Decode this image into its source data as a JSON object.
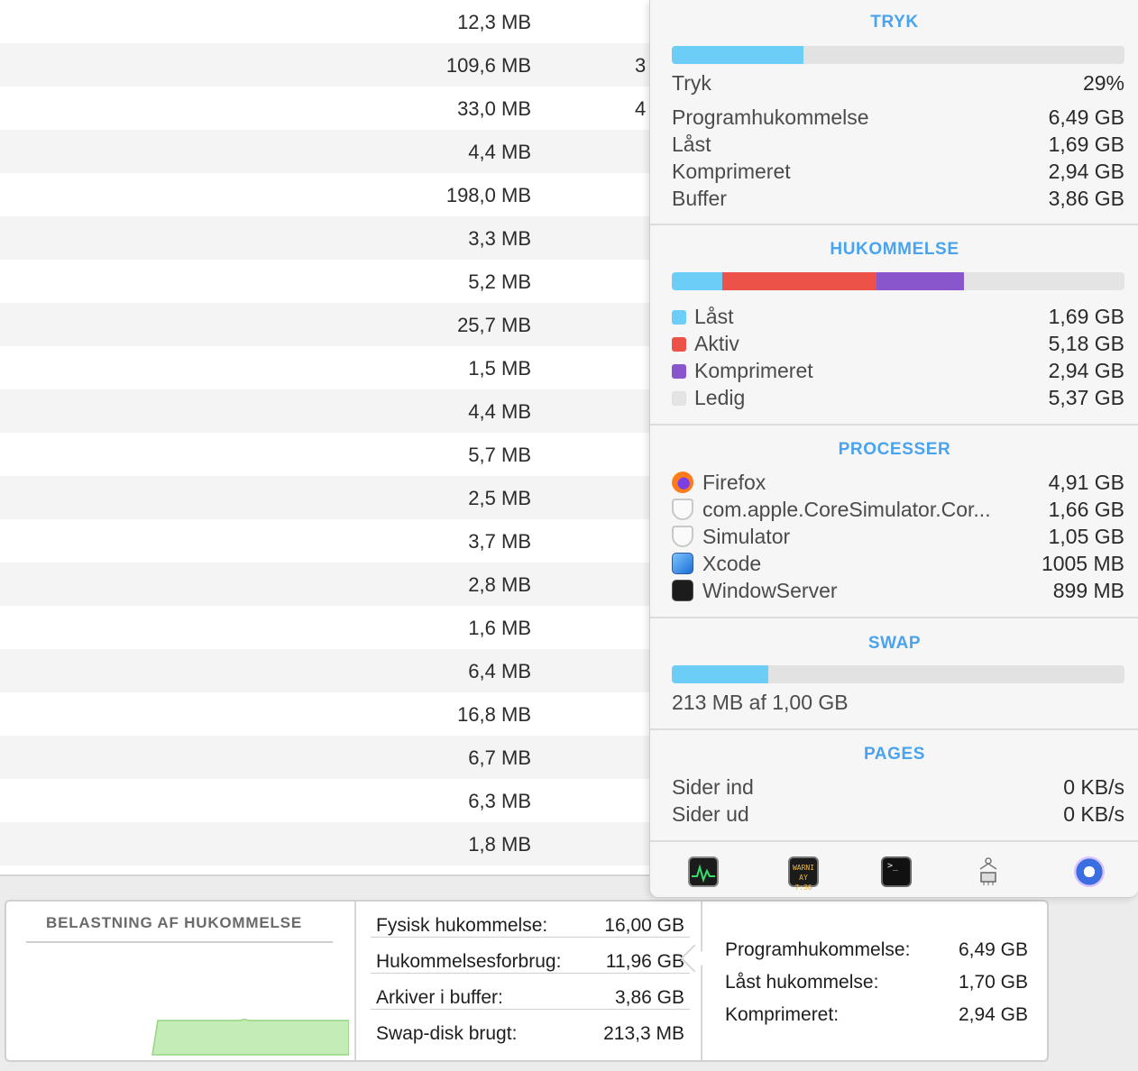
{
  "table": {
    "rows": [
      {
        "mem": "12,3 MB",
        "peek": ""
      },
      {
        "mem": "109,6 MB",
        "peek": "3"
      },
      {
        "mem": "33,0 MB",
        "peek": "4"
      },
      {
        "mem": "4,4 MB",
        "peek": ""
      },
      {
        "mem": "198,0 MB",
        "peek": ""
      },
      {
        "mem": "3,3 MB",
        "peek": ""
      },
      {
        "mem": "5,2 MB",
        "peek": ""
      },
      {
        "mem": "25,7 MB",
        "peek": ""
      },
      {
        "mem": "1,5 MB",
        "peek": ""
      },
      {
        "mem": "4,4 MB",
        "peek": ""
      },
      {
        "mem": "5,7 MB",
        "peek": ""
      },
      {
        "mem": "2,5 MB",
        "peek": ""
      },
      {
        "mem": "3,7 MB",
        "peek": ""
      },
      {
        "mem": "2,8 MB",
        "peek": ""
      },
      {
        "mem": "1,6 MB",
        "peek": ""
      },
      {
        "mem": "6,4 MB",
        "peek": ""
      },
      {
        "mem": "16,8 MB",
        "peek": ""
      },
      {
        "mem": "6,7 MB",
        "peek": ""
      },
      {
        "mem": "6,3 MB",
        "peek": ""
      },
      {
        "mem": "1,8 MB",
        "peek": ""
      }
    ]
  },
  "bottom": {
    "graph_title": "BELASTNING AF HUKOMMELSE",
    "stats": [
      {
        "label": "Fysisk hukommelse:",
        "value": "16,00 GB"
      },
      {
        "label": "Hukommelsesforbrug:",
        "value": "11,96 GB"
      },
      {
        "label": "Arkiver i buffer:",
        "value": "3,86 GB"
      },
      {
        "label": "Swap-disk brugt:",
        "value": "213,3 MB"
      }
    ],
    "details": [
      {
        "label": "Programhukommelse:",
        "value": "6,49 GB"
      },
      {
        "label": "Låst hukommelse:",
        "value": "1,70 GB"
      },
      {
        "label": "Komprimeret:",
        "value": "2,94 GB"
      }
    ]
  },
  "popover": {
    "tryk": {
      "title": "TRYK",
      "fill_fraction": 0.29,
      "pressure_label": "Tryk",
      "pressure_value": "29%",
      "rows": [
        {
          "label": "Programhukommelse",
          "value": "6,49 GB"
        },
        {
          "label": "Låst",
          "value": "1,69 GB"
        },
        {
          "label": "Komprimeret",
          "value": "2,94 GB"
        },
        {
          "label": "Buffer",
          "value": "3,86 GB"
        }
      ]
    },
    "hukommelse": {
      "title": "HUKOMMELSE",
      "rows": [
        {
          "label": "Låst",
          "value": "1,69 GB",
          "color": "#6ccdf7",
          "gb": 1.69
        },
        {
          "label": "Aktiv",
          "value": "5,18 GB",
          "color": "#ec5248",
          "gb": 5.18
        },
        {
          "label": "Komprimeret",
          "value": "2,94 GB",
          "color": "#8a56cc",
          "gb": 2.94
        },
        {
          "label": "Ledig",
          "value": "5,37 GB",
          "color": "#e4e4e4",
          "gb": 5.37
        }
      ]
    },
    "processer": {
      "title": "PROCESSER",
      "rows": [
        {
          "label": "Firefox",
          "value": "4,91 GB",
          "icon": "firefox-icon"
        },
        {
          "label": "com.apple.CoreSimulator.Cor...",
          "value": "1,66 GB",
          "icon": "shield-icon"
        },
        {
          "label": "Simulator",
          "value": "1,05 GB",
          "icon": "shield-icon"
        },
        {
          "label": "Xcode",
          "value": "1005 MB",
          "icon": "xcode-icon"
        },
        {
          "label": "WindowServer",
          "value": "899 MB",
          "icon": "terminal-icon"
        }
      ]
    },
    "swap": {
      "title": "SWAP",
      "fill_fraction": 0.213,
      "text": "213 MB af 1,00 GB"
    },
    "pages": {
      "title": "PAGES",
      "rows": [
        {
          "label": "Sider ind",
          "value": "0 KB/s"
        },
        {
          "label": "Sider ud",
          "value": "0 KB/s"
        }
      ]
    },
    "dock": {
      "console_text_1": "WARNI",
      "console_text_2": "AY 7:36",
      "terminal_prompt": ">_"
    }
  },
  "colors": {
    "accent": "#4aa3ee",
    "pressure_bar": "#6ccdf7",
    "swap_bar": "#6ccdf7",
    "graph_fill": "#c4ecb6"
  }
}
